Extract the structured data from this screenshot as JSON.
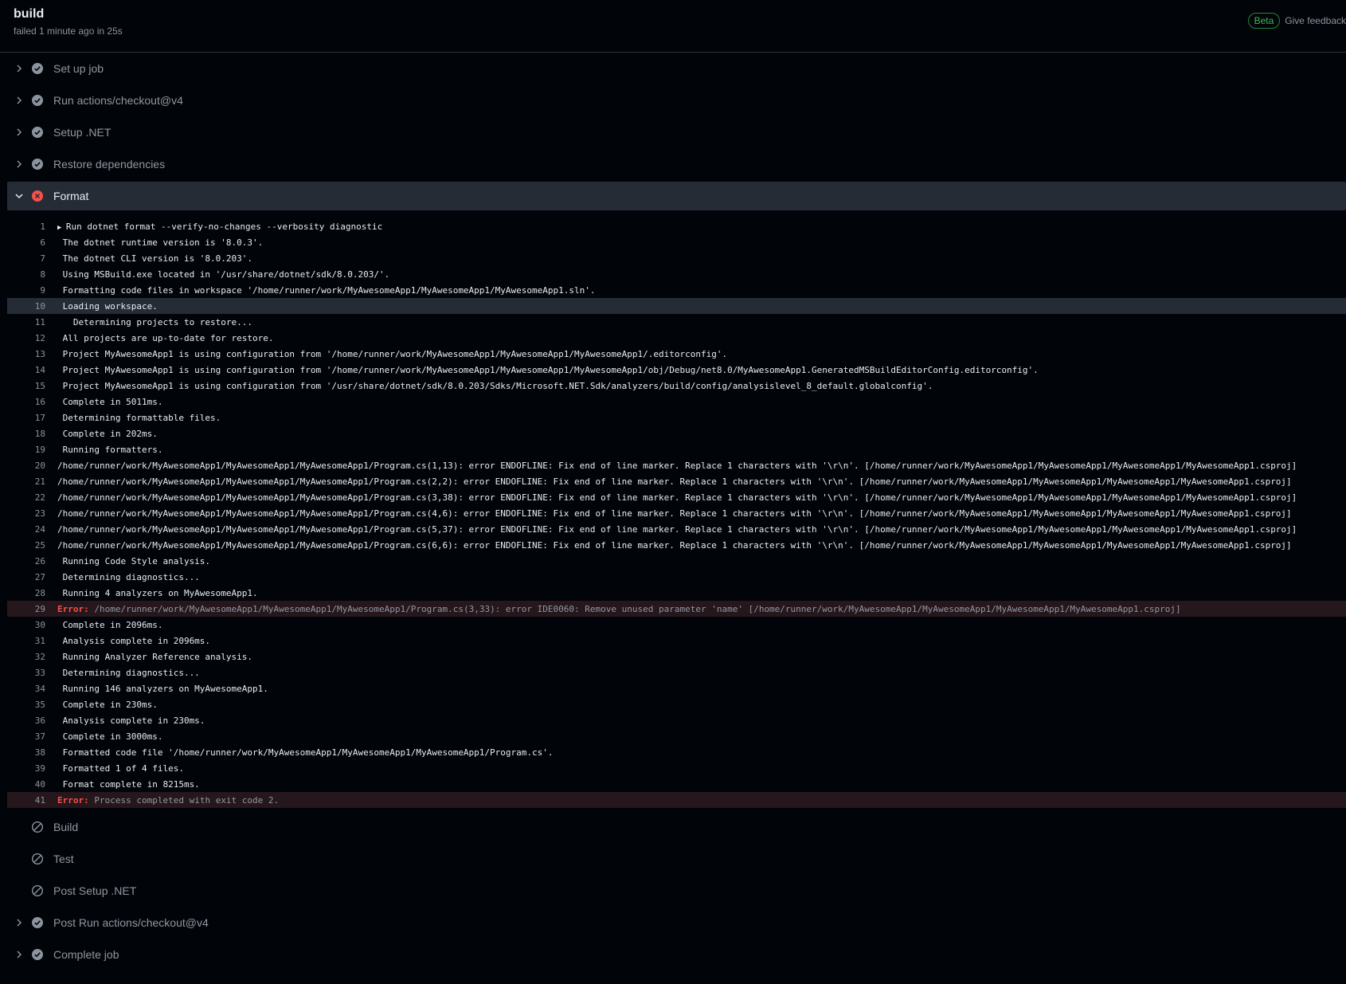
{
  "header": {
    "title": "build",
    "meta": "failed 1 minute ago in 25s",
    "beta_label": "Beta",
    "feedback_label": "Give feedback"
  },
  "colors": {
    "success": "#8b949e",
    "failure": "#f85149",
    "skipped": "#8b949e"
  },
  "steps_before": [
    {
      "name": "Set up job",
      "status": "success"
    },
    {
      "name": "Run actions/checkout@v4",
      "status": "success"
    },
    {
      "name": "Setup .NET",
      "status": "success"
    },
    {
      "name": "Restore dependencies",
      "status": "success"
    }
  ],
  "open_step": {
    "name": "Format",
    "status": "failure"
  },
  "log": [
    {
      "n": "1",
      "text": "Run dotnet format --verify-no-changes --verbosity diagnostic",
      "kind": "group"
    },
    {
      "n": "6",
      "text": " The dotnet runtime version is '8.0.3'."
    },
    {
      "n": "7",
      "text": " The dotnet CLI version is '8.0.203'."
    },
    {
      "n": "8",
      "text": " Using MSBuild.exe located in '/usr/share/dotnet/sdk/8.0.203/'."
    },
    {
      "n": "9",
      "text": " Formatting code files in workspace '/home/runner/work/MyAwesomeApp1/MyAwesomeApp1/MyAwesomeApp1.sln'."
    },
    {
      "n": "10",
      "text": " Loading workspace.",
      "kind": "hl"
    },
    {
      "n": "11",
      "text": "   Determining projects to restore..."
    },
    {
      "n": "12",
      "text": " All projects are up-to-date for restore."
    },
    {
      "n": "13",
      "text": " Project MyAwesomeApp1 is using configuration from '/home/runner/work/MyAwesomeApp1/MyAwesomeApp1/MyAwesomeApp1/.editorconfig'."
    },
    {
      "n": "14",
      "text": " Project MyAwesomeApp1 is using configuration from '/home/runner/work/MyAwesomeApp1/MyAwesomeApp1/MyAwesomeApp1/obj/Debug/net8.0/MyAwesomeApp1.GeneratedMSBuildEditorConfig.editorconfig'."
    },
    {
      "n": "15",
      "text": " Project MyAwesomeApp1 is using configuration from '/usr/share/dotnet/sdk/8.0.203/Sdks/Microsoft.NET.Sdk/analyzers/build/config/analysislevel_8_default.globalconfig'."
    },
    {
      "n": "16",
      "text": " Complete in 5011ms."
    },
    {
      "n": "17",
      "text": " Determining formattable files."
    },
    {
      "n": "18",
      "text": " Complete in 202ms."
    },
    {
      "n": "19",
      "text": " Running formatters."
    },
    {
      "n": "20",
      "text": "/home/runner/work/MyAwesomeApp1/MyAwesomeApp1/MyAwesomeApp1/Program.cs(1,13): error ENDOFLINE: Fix end of line marker. Replace 1 characters with '\\r\\n'. [/home/runner/work/MyAwesomeApp1/MyAwesomeApp1/MyAwesomeApp1/MyAwesomeApp1.csproj]"
    },
    {
      "n": "21",
      "text": "/home/runner/work/MyAwesomeApp1/MyAwesomeApp1/MyAwesomeApp1/Program.cs(2,2): error ENDOFLINE: Fix end of line marker. Replace 1 characters with '\\r\\n'. [/home/runner/work/MyAwesomeApp1/MyAwesomeApp1/MyAwesomeApp1/MyAwesomeApp1.csproj]"
    },
    {
      "n": "22",
      "text": "/home/runner/work/MyAwesomeApp1/MyAwesomeApp1/MyAwesomeApp1/Program.cs(3,38): error ENDOFLINE: Fix end of line marker. Replace 1 characters with '\\r\\n'. [/home/runner/work/MyAwesomeApp1/MyAwesomeApp1/MyAwesomeApp1/MyAwesomeApp1.csproj]"
    },
    {
      "n": "23",
      "text": "/home/runner/work/MyAwesomeApp1/MyAwesomeApp1/MyAwesomeApp1/Program.cs(4,6): error ENDOFLINE: Fix end of line marker. Replace 1 characters with '\\r\\n'. [/home/runner/work/MyAwesomeApp1/MyAwesomeApp1/MyAwesomeApp1/MyAwesomeApp1.csproj]"
    },
    {
      "n": "24",
      "text": "/home/runner/work/MyAwesomeApp1/MyAwesomeApp1/MyAwesomeApp1/Program.cs(5,37): error ENDOFLINE: Fix end of line marker. Replace 1 characters with '\\r\\n'. [/home/runner/work/MyAwesomeApp1/MyAwesomeApp1/MyAwesomeApp1/MyAwesomeApp1.csproj]"
    },
    {
      "n": "25",
      "text": "/home/runner/work/MyAwesomeApp1/MyAwesomeApp1/MyAwesomeApp1/Program.cs(6,6): error ENDOFLINE: Fix end of line marker. Replace 1 characters with '\\r\\n'. [/home/runner/work/MyAwesomeApp1/MyAwesomeApp1/MyAwesomeApp1/MyAwesomeApp1.csproj]"
    },
    {
      "n": "26",
      "text": " Running Code Style analysis."
    },
    {
      "n": "27",
      "text": " Determining diagnostics..."
    },
    {
      "n": "28",
      "text": " Running 4 analyzers on MyAwesomeApp1."
    },
    {
      "n": "29",
      "label": "Error:",
      "text": " /home/runner/work/MyAwesomeApp1/MyAwesomeApp1/MyAwesomeApp1/Program.cs(3,33): error IDE0060: Remove unused parameter 'name' [/home/runner/work/MyAwesomeApp1/MyAwesomeApp1/MyAwesomeApp1/MyAwesomeApp1.csproj]",
      "kind": "err"
    },
    {
      "n": "30",
      "text": " Complete in 2096ms."
    },
    {
      "n": "31",
      "text": " Analysis complete in 2096ms."
    },
    {
      "n": "32",
      "text": " Running Analyzer Reference analysis."
    },
    {
      "n": "33",
      "text": " Determining diagnostics..."
    },
    {
      "n": "34",
      "text": " Running 146 analyzers on MyAwesomeApp1."
    },
    {
      "n": "35",
      "text": " Complete in 230ms."
    },
    {
      "n": "36",
      "text": " Analysis complete in 230ms."
    },
    {
      "n": "37",
      "text": " Complete in 3000ms."
    },
    {
      "n": "38",
      "text": " Formatted code file '/home/runner/work/MyAwesomeApp1/MyAwesomeApp1/MyAwesomeApp1/Program.cs'."
    },
    {
      "n": "39",
      "text": " Formatted 1 of 4 files."
    },
    {
      "n": "40",
      "text": " Format complete in 8215ms."
    },
    {
      "n": "41",
      "label": "Error:",
      "text": " Process completed with exit code 2.",
      "kind": "err"
    }
  ],
  "steps_after": [
    {
      "name": "Build",
      "status": "skipped"
    },
    {
      "name": "Test",
      "status": "skipped"
    },
    {
      "name": "Post Setup .NET",
      "status": "skipped"
    },
    {
      "name": "Post Run actions/checkout@v4",
      "status": "success"
    },
    {
      "name": "Complete job",
      "status": "success"
    }
  ]
}
